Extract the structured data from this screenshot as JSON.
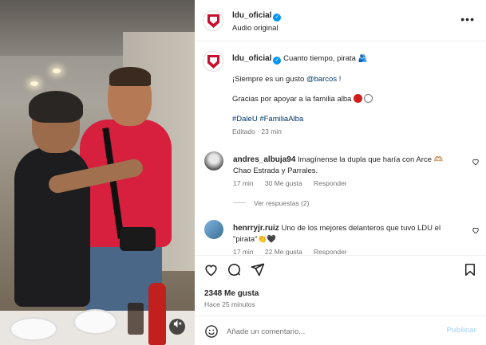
{
  "post": {
    "username": "ldu_oficial",
    "audio": "Audio original",
    "more_icon": "more-dots-icon"
  },
  "caption": {
    "username": "ldu_oficial",
    "text": "Cuanto tiempo, pirata 🫂",
    "line2_prefix": "¡Siempre es un gusto",
    "line2_mention": "@barcos",
    "line2_suffix": "!",
    "line3": "Gracias por apoyar a la familia alba",
    "hashtags": "#DaleU #FamiliaAlba",
    "meta": "Editado · 23 min",
    "colors": {
      "red_dot": "#d21d1d",
      "white_dot": "#ffffff"
    }
  },
  "comments": [
    {
      "username": "andres_albuja94",
      "text": "Imagínense la dupla que haría con Arce 🫶🏼 Chao Estrada y Parrales.",
      "time": "17 min",
      "likes": "30 Me gusta",
      "reply": "Responder"
    },
    {
      "username": "henrryjr.ruiz",
      "text": "Uno de los mejores delanteros que tuvo LDU el \"pirata\"👏🖤",
      "time": "17 min",
      "likes": "22 Me gusta",
      "reply": "Responder"
    }
  ],
  "view_replies": "Ver respuestas (2)",
  "actions": {
    "likes": "2348 Me gusta",
    "ago": "Hace 25 minutos"
  },
  "composer": {
    "placeholder": "Añade un comentario...",
    "publish": "Publicar"
  },
  "media": {
    "mute_icon": "speaker-muted-icon"
  },
  "accent": "#0095f6"
}
